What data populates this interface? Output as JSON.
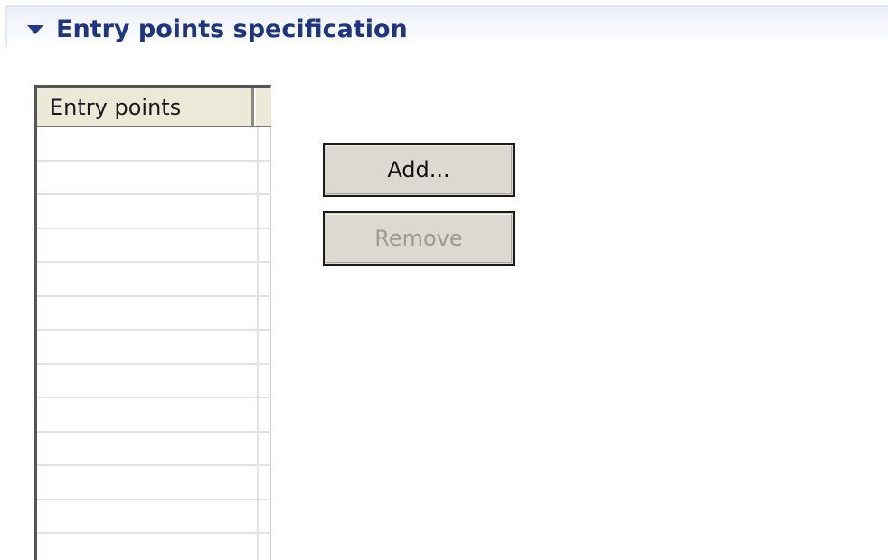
{
  "section": {
    "title": "Entry points specification",
    "expanded": true,
    "title_color": "#1d3584"
  },
  "table": {
    "columns": [
      "Entry points"
    ],
    "rows": [],
    "empty_row_count": 13
  },
  "buttons": {
    "add_label": "Add...",
    "remove_label": "Remove",
    "remove_enabled": false
  }
}
